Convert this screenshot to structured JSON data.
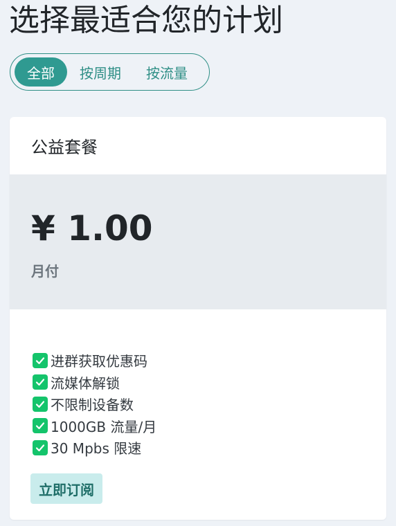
{
  "page_title": "选择最适合您的计划",
  "filters": [
    {
      "label": "全部",
      "active": true
    },
    {
      "label": "按周期",
      "active": false
    },
    {
      "label": "按流量",
      "active": false
    }
  ],
  "plan": {
    "name": "公益套餐",
    "price": "¥ 1.00",
    "period": "月付",
    "features": [
      "进群获取优惠码",
      "流媒体解锁",
      "不限制设备数",
      "1000GB 流量/月",
      "30 Mpbs 限速"
    ],
    "subscribe_label": "立即订阅"
  },
  "colors": {
    "accent": "#2f9a91",
    "check": "#14c46b",
    "background": "#eef2f7",
    "price_block": "#e7ebef",
    "button_bg": "#c9ecec"
  },
  "icons": {
    "feature_check": "check-box-icon"
  }
}
